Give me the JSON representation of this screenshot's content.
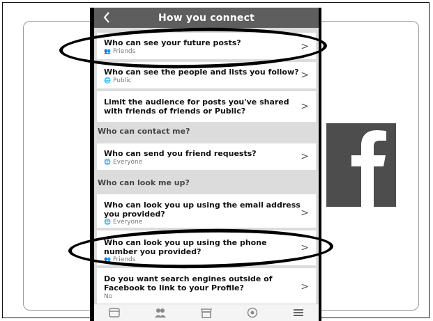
{
  "nav": {
    "title": "How you connect"
  },
  "rows": [
    {
      "title": "Who can see your future posts?",
      "subtitle": "Friends",
      "subtitle_icon": "friends-icon"
    },
    {
      "title": "Who can see the people and lists you follow?",
      "subtitle": "Public",
      "subtitle_icon": "globe-icon"
    },
    {
      "title": "Limit the audience for posts you've shared with friends of friends or Public?",
      "subtitle": ""
    },
    {
      "title": "Who can send you friend requests?",
      "subtitle": "Everyone",
      "subtitle_icon": "globe-icon"
    },
    {
      "title": "Who can look you up using the email address you provided?",
      "subtitle": "Everyone",
      "subtitle_icon": "globe-icon"
    },
    {
      "title": "Who can look you up using the phone number you provided?",
      "subtitle": "Friends",
      "subtitle_icon": "friends-icon"
    },
    {
      "title": "Do you want search engines outside of Facebook to link to your Profile?",
      "subtitle": "No"
    }
  ],
  "sections": [
    {
      "label": "Who can contact me?"
    },
    {
      "label": "Who can look me up?"
    }
  ],
  "tabbar": [
    "news-feed-icon",
    "friends-icon",
    "marketplace-icon",
    "notifications-icon",
    "menu-icon"
  ],
  "colors": {
    "navbar": "#5e5e5e",
    "background": "#dcdcdc",
    "logo_bg": "#4d4d4d",
    "highlight": "#000000"
  }
}
